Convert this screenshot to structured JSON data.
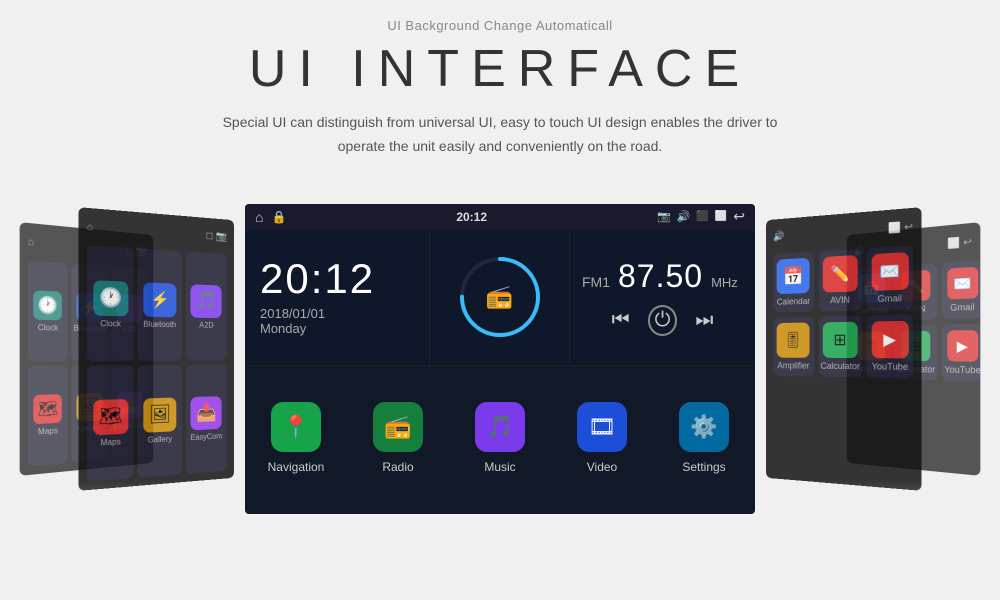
{
  "header": {
    "subtitle": "UI Background Change Automaticall",
    "title": "UI  INTERFACE",
    "description_line1": "Special UI can distinguish from universal UI, easy to touch UI design enables the driver to",
    "description_line2": "operate the unit easily and conveniently on the road."
  },
  "main_screen": {
    "status_bar": {
      "time": "20:12",
      "icons": [
        "📷",
        "🔊",
        "⬛",
        "⬜",
        "↩"
      ]
    },
    "clock_widget": {
      "time": "20:12",
      "date": "2018/01/01",
      "day": "Monday"
    },
    "fm_widget": {
      "label": "FM1",
      "frequency": "87.50",
      "unit": "MHz"
    },
    "apps": [
      {
        "label": "Navigation",
        "icon": "📍",
        "color": "#16a34a"
      },
      {
        "label": "Radio",
        "icon": "📻",
        "color": "#15803d"
      },
      {
        "label": "Music",
        "icon": "🎵",
        "color": "#7c3aed"
      },
      {
        "label": "Video",
        "icon": "🎞",
        "color": "#1d4ed8"
      },
      {
        "label": "Settings",
        "icon": "⚙️",
        "color": "#0369a1"
      }
    ]
  },
  "left_screen": {
    "apps": [
      {
        "label": "Clock",
        "icon": "🕐",
        "color": "#0f766e"
      },
      {
        "label": "Bluetooth",
        "icon": "✱",
        "color": "#1d4ed8"
      },
      {
        "label": "A2D",
        "icon": "🎵",
        "color": "#7c3aed"
      },
      {
        "label": "Maps",
        "icon": "🗺",
        "color": "#dc2626"
      },
      {
        "label": "Gallery",
        "icon": "🖼",
        "color": "#ca8a04"
      },
      {
        "label": "EasyCom",
        "icon": "📤",
        "color": "#9333ea"
      }
    ]
  },
  "right_screen": {
    "apps": [
      {
        "label": "Calendar",
        "icon": "📅",
        "color": "#2563eb"
      },
      {
        "label": "AVIN",
        "icon": "✏️",
        "color": "#dc2626"
      },
      {
        "label": "Gmail",
        "icon": "✉️",
        "color": "#dc2626"
      },
      {
        "label": "Amplifier",
        "icon": "🎚",
        "color": "#ca8a04"
      },
      {
        "label": "Calculator",
        "icon": "⊞",
        "color": "#16a34a"
      },
      {
        "label": "YouTube",
        "icon": "▶",
        "color": "#dc2626"
      }
    ]
  },
  "dots": [
    {
      "active": false
    },
    {
      "active": true
    },
    {
      "active": false
    },
    {
      "active": false
    }
  ]
}
